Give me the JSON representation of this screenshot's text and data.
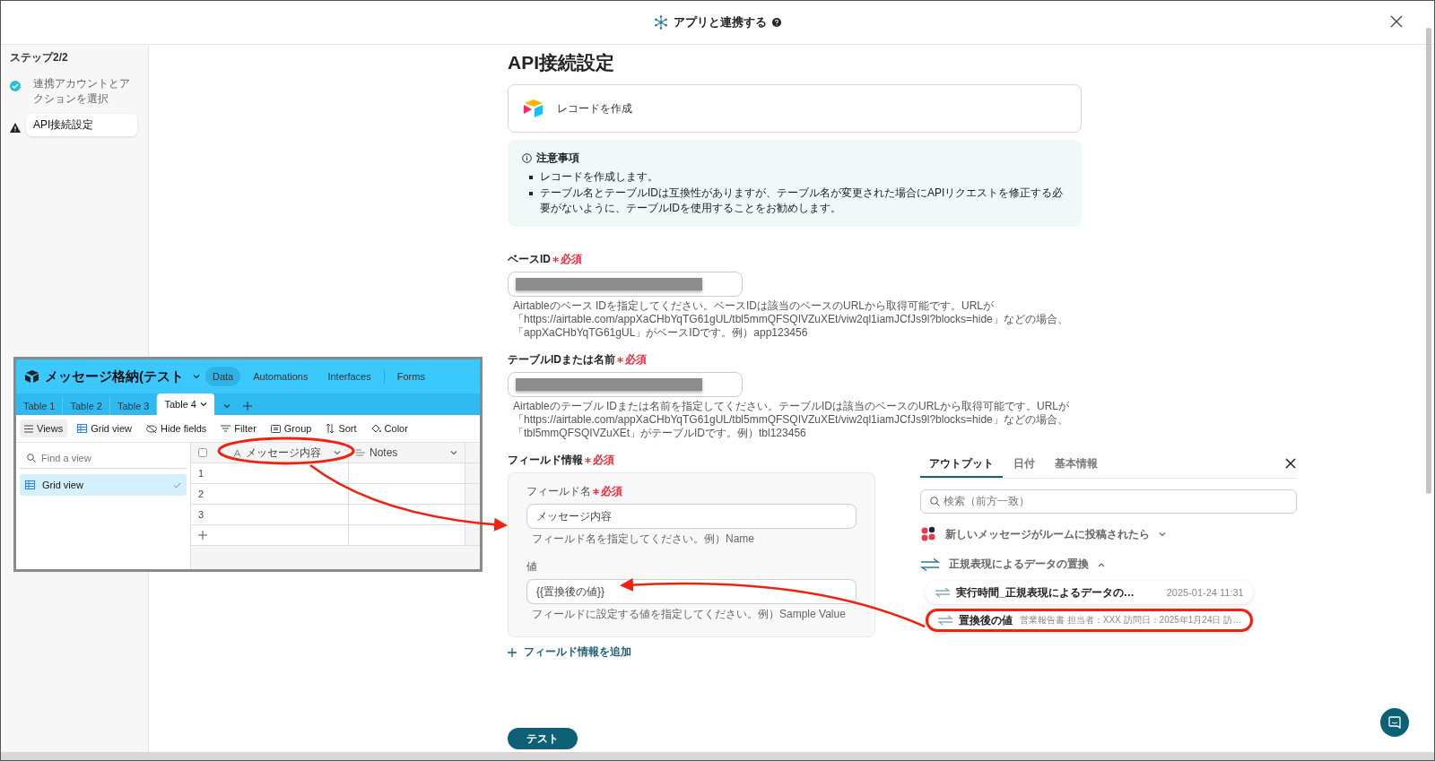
{
  "header": {
    "title": "アプリと連携する"
  },
  "sidebar": {
    "step": "ステップ2/2",
    "steps": [
      {
        "label": "連携アカウントとアクションを選択",
        "completed": true,
        "selected": false
      },
      {
        "label": "API接続設定",
        "completed": false,
        "selected": true
      }
    ]
  },
  "main": {
    "title": "API接続設定",
    "action": "レコードを作成",
    "notice": {
      "title": "注意事項",
      "items": [
        "レコードを作成します。",
        "テーブル名とテーブルIDは互換性がありますが、テーブル名が変更された場合にAPIリクエストを修正する必要がないように、テーブルIDを使用することをお勧めします。"
      ]
    },
    "fields": [
      {
        "label": "ベースID",
        "required": "必須",
        "help": "Airtableのベース IDを指定してください。ベースIDは該当のベースのURLから取得可能です。URLが「https://airtable.com/appXaCHbYqTG61gUL/tbl5mmQFSQIVZuXEt/viw2ql1iamJCfJs9l?blocks=hide」などの場合、「appXaCHbYqTG61gUL」がベースIDです。例）app123456"
      },
      {
        "label": "テーブルIDまたは名前",
        "required": "必須",
        "help": "Airtableのテーブル IDまたは名前を指定してください。テーブルIDは該当のベースのURLから取得可能です。URLが「https://airtable.com/appXaCHbYqTG61gUL/tbl5mmQFSQIVZuXEt/viw2ql1iamJCfJs9l?blocks=hide」などの場合、「tbl5mmQFSQIVZuXEt」がテーブルIDです。例）tbl123456"
      }
    ],
    "field_info": {
      "label": "フィールド情報",
      "required": "必須",
      "name_label": "フィールド名",
      "name_required": "必須",
      "name_value": "メッセージ内容",
      "name_help": "フィールド名を指定してください。例）Name",
      "value_label": "値",
      "value_value": "{{置換後の値}}",
      "value_help": "フィールドに設定する値を指定してください。例）Sample Value"
    },
    "add_link": "フィールド情報を追加",
    "test_button": "テスト"
  },
  "airtable": {
    "base_name": "メッセージ格納(テスト",
    "nav": [
      {
        "label": "Data",
        "selected": true
      },
      {
        "label": "Automations",
        "selected": false
      },
      {
        "label": "Interfaces",
        "selected": false
      },
      {
        "label": "Forms",
        "selected": false
      }
    ],
    "tables": [
      {
        "label": "Table 1",
        "selected": false
      },
      {
        "label": "Table 2",
        "selected": false
      },
      {
        "label": "Table 3",
        "selected": false
      },
      {
        "label": "Table 4",
        "selected": true
      }
    ],
    "toolbar": [
      "Views",
      "Grid view",
      "Hide fields",
      "Filter",
      "Group",
      "Sort",
      "Color"
    ],
    "find_placeholder": "Find a view",
    "views": [
      {
        "label": "Grid view",
        "selected": true
      }
    ],
    "columns": [
      "メッセージ内容",
      "Notes"
    ],
    "rows": [
      "1",
      "2",
      "3"
    ]
  },
  "output_panel": {
    "tabs": [
      {
        "label": "アウトプット",
        "selected": true
      },
      {
        "label": "日付",
        "selected": false
      },
      {
        "label": "基本情報",
        "selected": false
      }
    ],
    "search_placeholder": "検索（前方一致）",
    "groups": [
      {
        "kind": "app",
        "title": "新しいメッセージがルームに投稿されたら",
        "expanded": false
      },
      {
        "kind": "transform",
        "title": "正規表現によるデータの置換",
        "expanded": true,
        "items": [
          {
            "name": "実行時間_正規表現によるデータの…",
            "value": "2025-01-24 11:31",
            "highlighted": false
          },
          {
            "name": "置換後の値",
            "value": "営業報告書 担当者：XXX 訪問日：2025年1月24日 訪…",
            "highlighted": true
          }
        ]
      }
    ]
  }
}
